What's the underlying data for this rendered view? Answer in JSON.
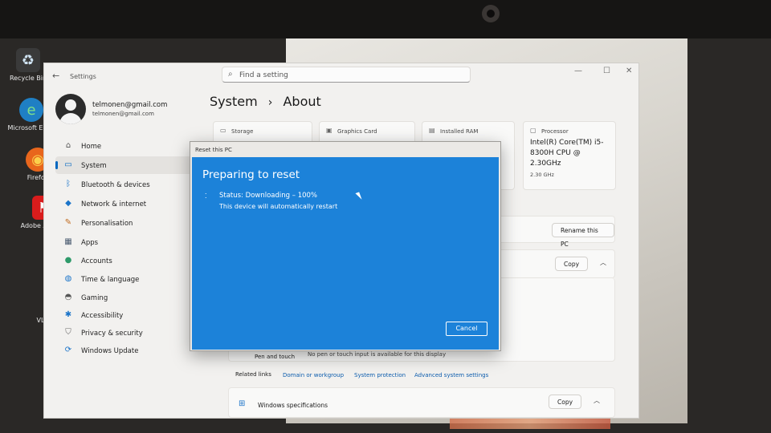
{
  "desktop_icons": [
    {
      "label": "Recycle Bin",
      "icon": "recycle-bin-icon"
    },
    {
      "label": "Microsoft Edge",
      "icon": "edge-icon"
    },
    {
      "label": "Firefox",
      "icon": "firefox-icon"
    },
    {
      "label": "Adobe Acrobat",
      "icon": "acrobat-icon"
    },
    {
      "label": "VLC media player",
      "icon": "vlc-icon"
    }
  ],
  "settings": {
    "app_title": "Settings",
    "search_placeholder": "Find a setting",
    "user": {
      "name": "telmonen@gmail.com",
      "email": "telmonen@gmail.com"
    },
    "nav": [
      {
        "label": "Home",
        "icon": "home-icon",
        "active": false
      },
      {
        "label": "System",
        "icon": "system-icon",
        "active": true
      },
      {
        "label": "Bluetooth & devices",
        "icon": "bluetooth-icon",
        "active": false
      },
      {
        "label": "Network & internet",
        "icon": "network-icon",
        "active": false
      },
      {
        "label": "Personalisation",
        "icon": "brush-icon",
        "active": false
      },
      {
        "label": "Apps",
        "icon": "apps-icon",
        "active": false
      },
      {
        "label": "Accounts",
        "icon": "accounts-icon",
        "active": false
      },
      {
        "label": "Time & language",
        "icon": "globe-icon",
        "active": false
      },
      {
        "label": "Gaming",
        "icon": "gaming-icon",
        "active": false
      },
      {
        "label": "Accessibility",
        "icon": "accessibility-icon",
        "active": false
      },
      {
        "label": "Privacy & security",
        "icon": "shield-icon",
        "active": false
      },
      {
        "label": "Windows Update",
        "icon": "update-icon",
        "active": false
      }
    ],
    "breadcrumb": {
      "parent": "System",
      "separator": "›",
      "current": "About"
    },
    "specs": [
      {
        "label": "Storage",
        "value": "",
        "sub": ""
      },
      {
        "label": "Graphics Card",
        "value": "",
        "sub": ""
      },
      {
        "label": "Installed RAM",
        "value": "",
        "sub": ""
      },
      {
        "label": "Processor",
        "value": "Intel(R) Core(TM) i5-8300H CPU @ 2.30GHz",
        "sub": "2.30 GHz"
      }
    ],
    "rename_button": "Rename this PC",
    "copy_button_1": "Copy",
    "pen_touch": {
      "key": "Pen and touch",
      "value": "No pen or touch input is available for this display"
    },
    "related": {
      "label": "Related links",
      "links": [
        "Domain or workgroup",
        "System protection",
        "Advanced system settings"
      ]
    },
    "windows_spec": {
      "label": "Windows specifications",
      "copy": "Copy"
    }
  },
  "reset_dialog": {
    "title": "Reset this PC",
    "heading": "Preparing to reset",
    "status": "Status: Downloading – 100%",
    "note": "This device will automatically restart",
    "cancel": "Cancel",
    "progress_percent": 100,
    "accent_color": "#1c82d9"
  }
}
